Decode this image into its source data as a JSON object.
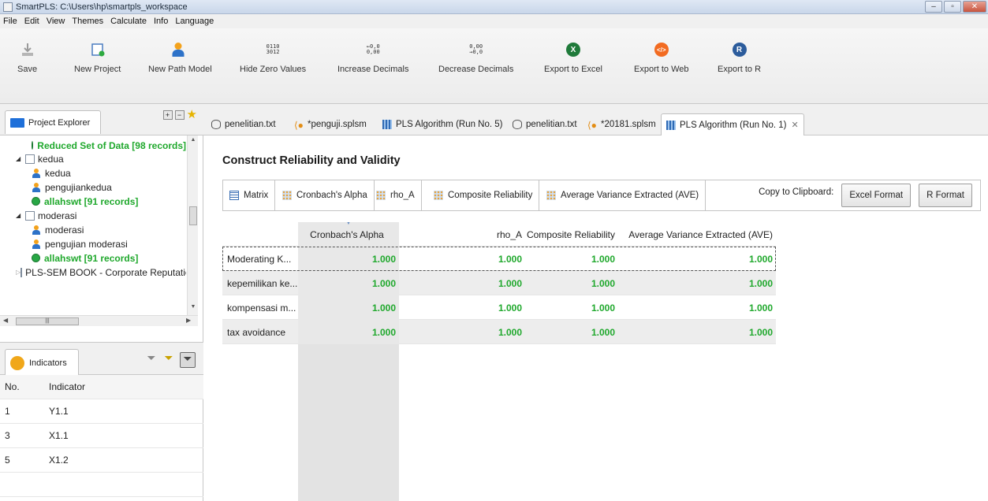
{
  "window": {
    "title": "SmartPLS: C:\\Users\\hp\\smartpls_workspace"
  },
  "menu": [
    "File",
    "Edit",
    "View",
    "Themes",
    "Calculate",
    "Info",
    "Language"
  ],
  "toolbar": {
    "save": "Save",
    "new_project": "New Project",
    "new_path_model": "New Path Model",
    "hide_zero": "Hide Zero Values",
    "hide_zero_icon": "0110\n3012",
    "increase_decimals": "Increase Decimals",
    "increase_icon": "←0,0\n0,00",
    "decrease_decimals": "Decrease Decimals",
    "decrease_icon": "0,00\n→0,0",
    "export_excel": "Export to Excel",
    "export_web": "Export to Web",
    "export_r": "Export to R",
    "excel_glyph": "X",
    "web_glyph": "</>",
    "r_glyph": "R",
    "colors": {
      "excel": "#1f7a3a",
      "web": "#f26b21",
      "r": "#2c5c9c"
    }
  },
  "project_explorer": {
    "tab_label": "Project Explorer",
    "tree": [
      {
        "label": "Reduced Set of Data [98 records]",
        "type": "data",
        "indent": 2
      },
      {
        "label": "kedua",
        "type": "project",
        "indent": 1
      },
      {
        "label": "kedua",
        "type": "model",
        "indent": 2
      },
      {
        "label": "pengujiankedua",
        "type": "model",
        "indent": 2
      },
      {
        "label": "allahswt [91 records]",
        "type": "data",
        "indent": 2
      },
      {
        "label": "moderasi",
        "type": "project",
        "indent": 1
      },
      {
        "label": "moderasi",
        "type": "model",
        "indent": 2
      },
      {
        "label": "pengujian moderasi",
        "type": "model",
        "indent": 2
      },
      {
        "label": "allahswt [91 records]",
        "type": "data",
        "indent": 2
      },
      {
        "label": "PLS-SEM BOOK - Corporate Reputation",
        "type": "project-collapsed",
        "indent": 1
      }
    ]
  },
  "indicators": {
    "tab_label": "Indicators",
    "columns": [
      "No.",
      "Indicator"
    ],
    "rows": [
      {
        "no": "1",
        "indicator": "Y1.1"
      },
      {
        "no": "3",
        "indicator": "X1.1"
      },
      {
        "no": "5",
        "indicator": "X1.2"
      }
    ]
  },
  "editor_tabs": [
    {
      "label": "penelitian.txt",
      "icon": "database-icon"
    },
    {
      "label": "*penguji.splsm",
      "icon": "model-icon"
    },
    {
      "label": "PLS Algorithm (Run No. 5)",
      "icon": "report-icon"
    },
    {
      "label": "penelitian.txt",
      "icon": "database-icon"
    },
    {
      "label": "*20181.splsm",
      "icon": "model-icon"
    },
    {
      "label": "PLS Algorithm (Run No. 1)",
      "icon": "report-icon",
      "active": true
    }
  ],
  "report": {
    "heading": "Construct Reliability and Validity",
    "subtabs": [
      "Matrix",
      "Cronbach's Alpha",
      "rho_A",
      "Composite Reliability",
      "Average Variance Extracted (AVE)"
    ],
    "copy_label": "Copy to Clipboard:",
    "excel_format": "Excel Format",
    "r_format": "R Format",
    "columns": [
      "",
      "Cronbach's Alpha",
      "rho_A",
      "Composite Reliability",
      "Average Variance Extracted (AVE)"
    ],
    "rows": [
      {
        "name": "Moderating K...",
        "values": [
          "1.000",
          "1.000",
          "1.000",
          "1.000"
        ]
      },
      {
        "name": "kepemilikan ke...",
        "values": [
          "1.000",
          "1.000",
          "1.000",
          "1.000"
        ]
      },
      {
        "name": "kompensasi m...",
        "values": [
          "1.000",
          "1.000",
          "1.000",
          "1.000"
        ]
      },
      {
        "name": "tax avoidance",
        "values": [
          "1.000",
          "1.000",
          "1.000",
          "1.000"
        ]
      }
    ]
  }
}
